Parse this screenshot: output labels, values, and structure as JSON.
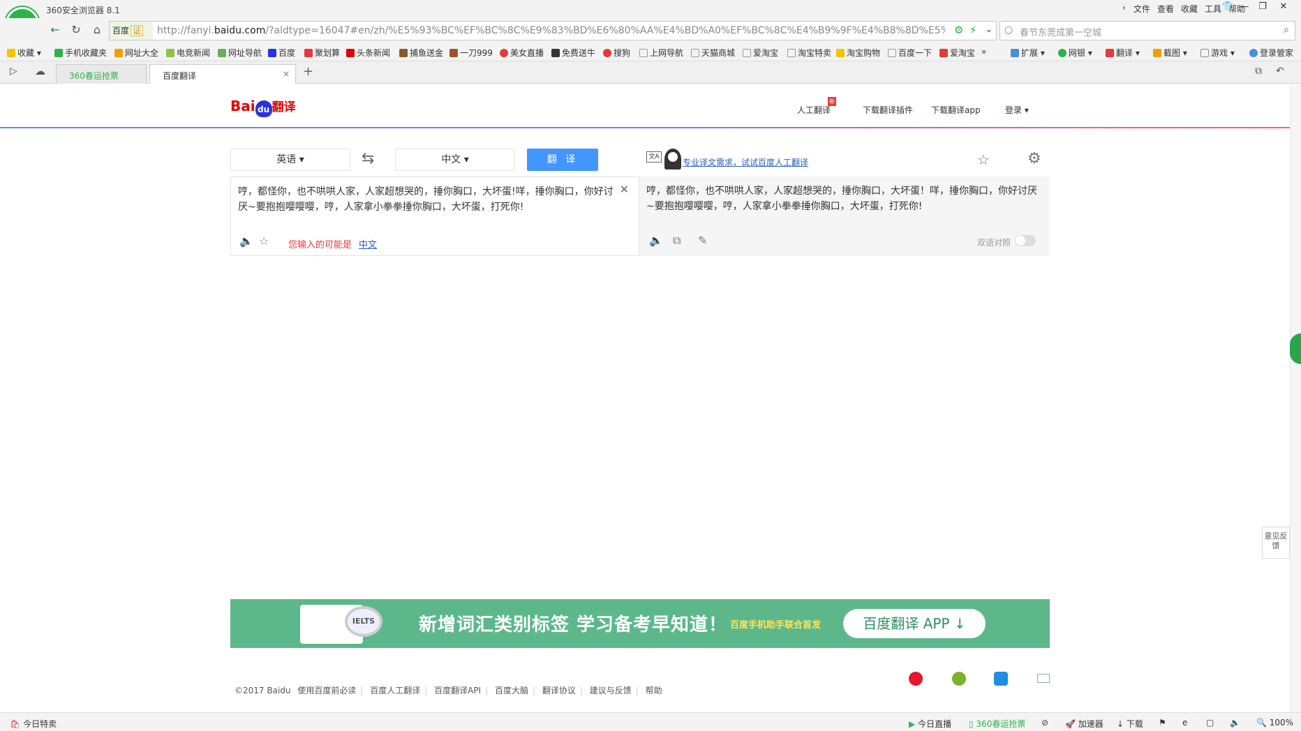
{
  "browser": {
    "app_title": "360安全浏览器 8.1",
    "menus": [
      "文件",
      "查看",
      "收藏",
      "工具",
      "帮助"
    ],
    "cert_label": "百度",
    "cert_badge": "证",
    "url_prefix": "http://fanyi.",
    "url_domain": "baidu.com",
    "url_rest": "/?aldtype=16047#en/zh/%E5%93%BC%EF%BC%8C%E9%83%BD%E6%80%AA%E4%BD%A0%EF%BC%8C%E4%B9%9F%E4%B8%8D%E5%93%84",
    "search_placeholder": "春节东莞成第一空城",
    "bookmarks": [
      "收藏",
      "手机收藏夹",
      "网址大全",
      "电竞新闻",
      "网址导航",
      "百度",
      "聚划算",
      "头条新闻",
      "捕鱼送金",
      "一刀999",
      "美女直播",
      "免费送牛",
      "搜狗",
      "上网导航",
      "天猫商城",
      "爱淘宝",
      "淘宝特卖",
      "淘宝购物",
      "百度一下",
      "爱淘宝"
    ],
    "bookmarks_right": [
      "扩展",
      "网银",
      "翻译",
      "截图",
      "游戏",
      "登录管家"
    ],
    "tabs": [
      "360春运抢票",
      "百度翻译"
    ]
  },
  "page": {
    "logo_text_left": "Bai",
    "logo_du": "du",
    "logo_text_right": "翻译",
    "top_links": [
      "人工翻译",
      "下载翻译插件",
      "下载翻译app",
      "登录"
    ],
    "new_badge": "新",
    "source_lang": "英语",
    "target_lang": "中文",
    "translate_button": "翻 译",
    "human_ad": "专业译文需求，试试百度人工翻译",
    "input_text": "哼，都怪你，也不哄哄人家，人家超想哭的，捶你胸口，大坏蛋!咩，捶你胸口，你好讨厌~要抱抱嘤嘤嘤，哼，人家拿小拳拳捶你胸口，大坏蛋，打死你!",
    "output_text": "哼，都怪你，也不哄哄人家，人家超想哭的，捶你胸口，大坏蛋！咩，捶你胸口，你好讨厌~要抱抱嘤嘤嘤，哼，人家拿小拳拳捶你胸口，大坏蛋，打死你!",
    "maybe_label": "您输入的可能是",
    "maybe_link": "中文",
    "bilingual_label": "双语对照",
    "banner_headline": "新增词汇类别标签 学习备考早知道！",
    "banner_sub": "百度手机助手联合首发",
    "banner_button": "百度翻译 APP ↓",
    "banner_badge": "IELTS",
    "footer_links": [
      "©2017 Baidu",
      "使用百度前必读",
      "百度人工翻译",
      "百度翻译API",
      "百度大脑",
      "翻译协议",
      "建议与反馈",
      "帮助"
    ],
    "feedback": "意见反馈"
  },
  "statusbar": {
    "left": "今日特卖",
    "items": [
      "今日直播",
      "360春运抢票",
      "加速器",
      "下载"
    ],
    "zoom": "100%"
  },
  "colors": {
    "accent": "#4395ff",
    "brand_red": "#e10602",
    "banner": "#5cb88a",
    "browser_green": "#2db34a"
  }
}
